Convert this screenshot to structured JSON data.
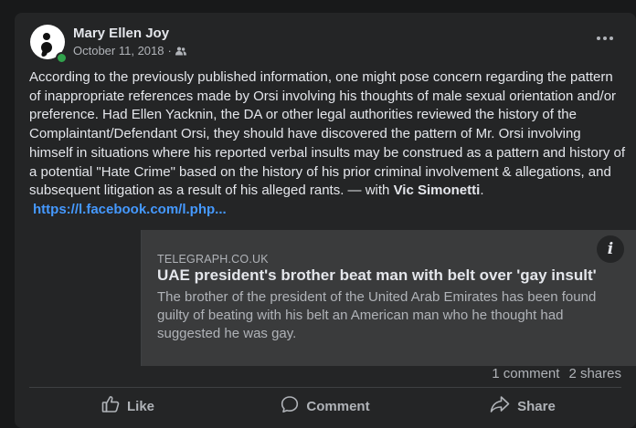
{
  "post": {
    "author": "Mary Ellen Joy",
    "date": "October 11, 2018",
    "separator": "·",
    "audience_icon": "friends-icon",
    "body_main": "According to the previously published information, one might pose concern regarding the pattern of inappropriate references made by Orsi involving his thoughts of male sexual orientation and/or preference.   Had Ellen Yacknin, the DA or other legal authorities reviewed the history of the Complaintant/Defendant Orsi, they should  have discovered the pattern of Mr. Orsi involving himself in situations where his reported verbal insults may be construed as a pattern and history of a potential \"Hate Crime\" based on the history of his prior criminal involvement & allegations, and subsequent litigation as a result of his alleged rants.  — with ",
    "tagged": "Vic Simonetti",
    "body_end": ".",
    "link": "https://l.facebook.com/l.php..."
  },
  "preview": {
    "domain": "TELEGRAPH.CO.UK",
    "title": "UAE president's brother beat man with belt over 'gay insult'",
    "description": "The brother of the president of the United Arab Emirates has been found guilty of beating with his belt an American man who he thought had suggested he was gay.",
    "info_icon": "i"
  },
  "stats": {
    "comments": "1 comment",
    "shares": "2 shares"
  },
  "actions": {
    "like": "Like",
    "comment": "Comment",
    "share": "Share"
  },
  "colors": {
    "background": "#18191a",
    "card": "#242526",
    "link": "#4599ff",
    "online": "#31a24c"
  }
}
